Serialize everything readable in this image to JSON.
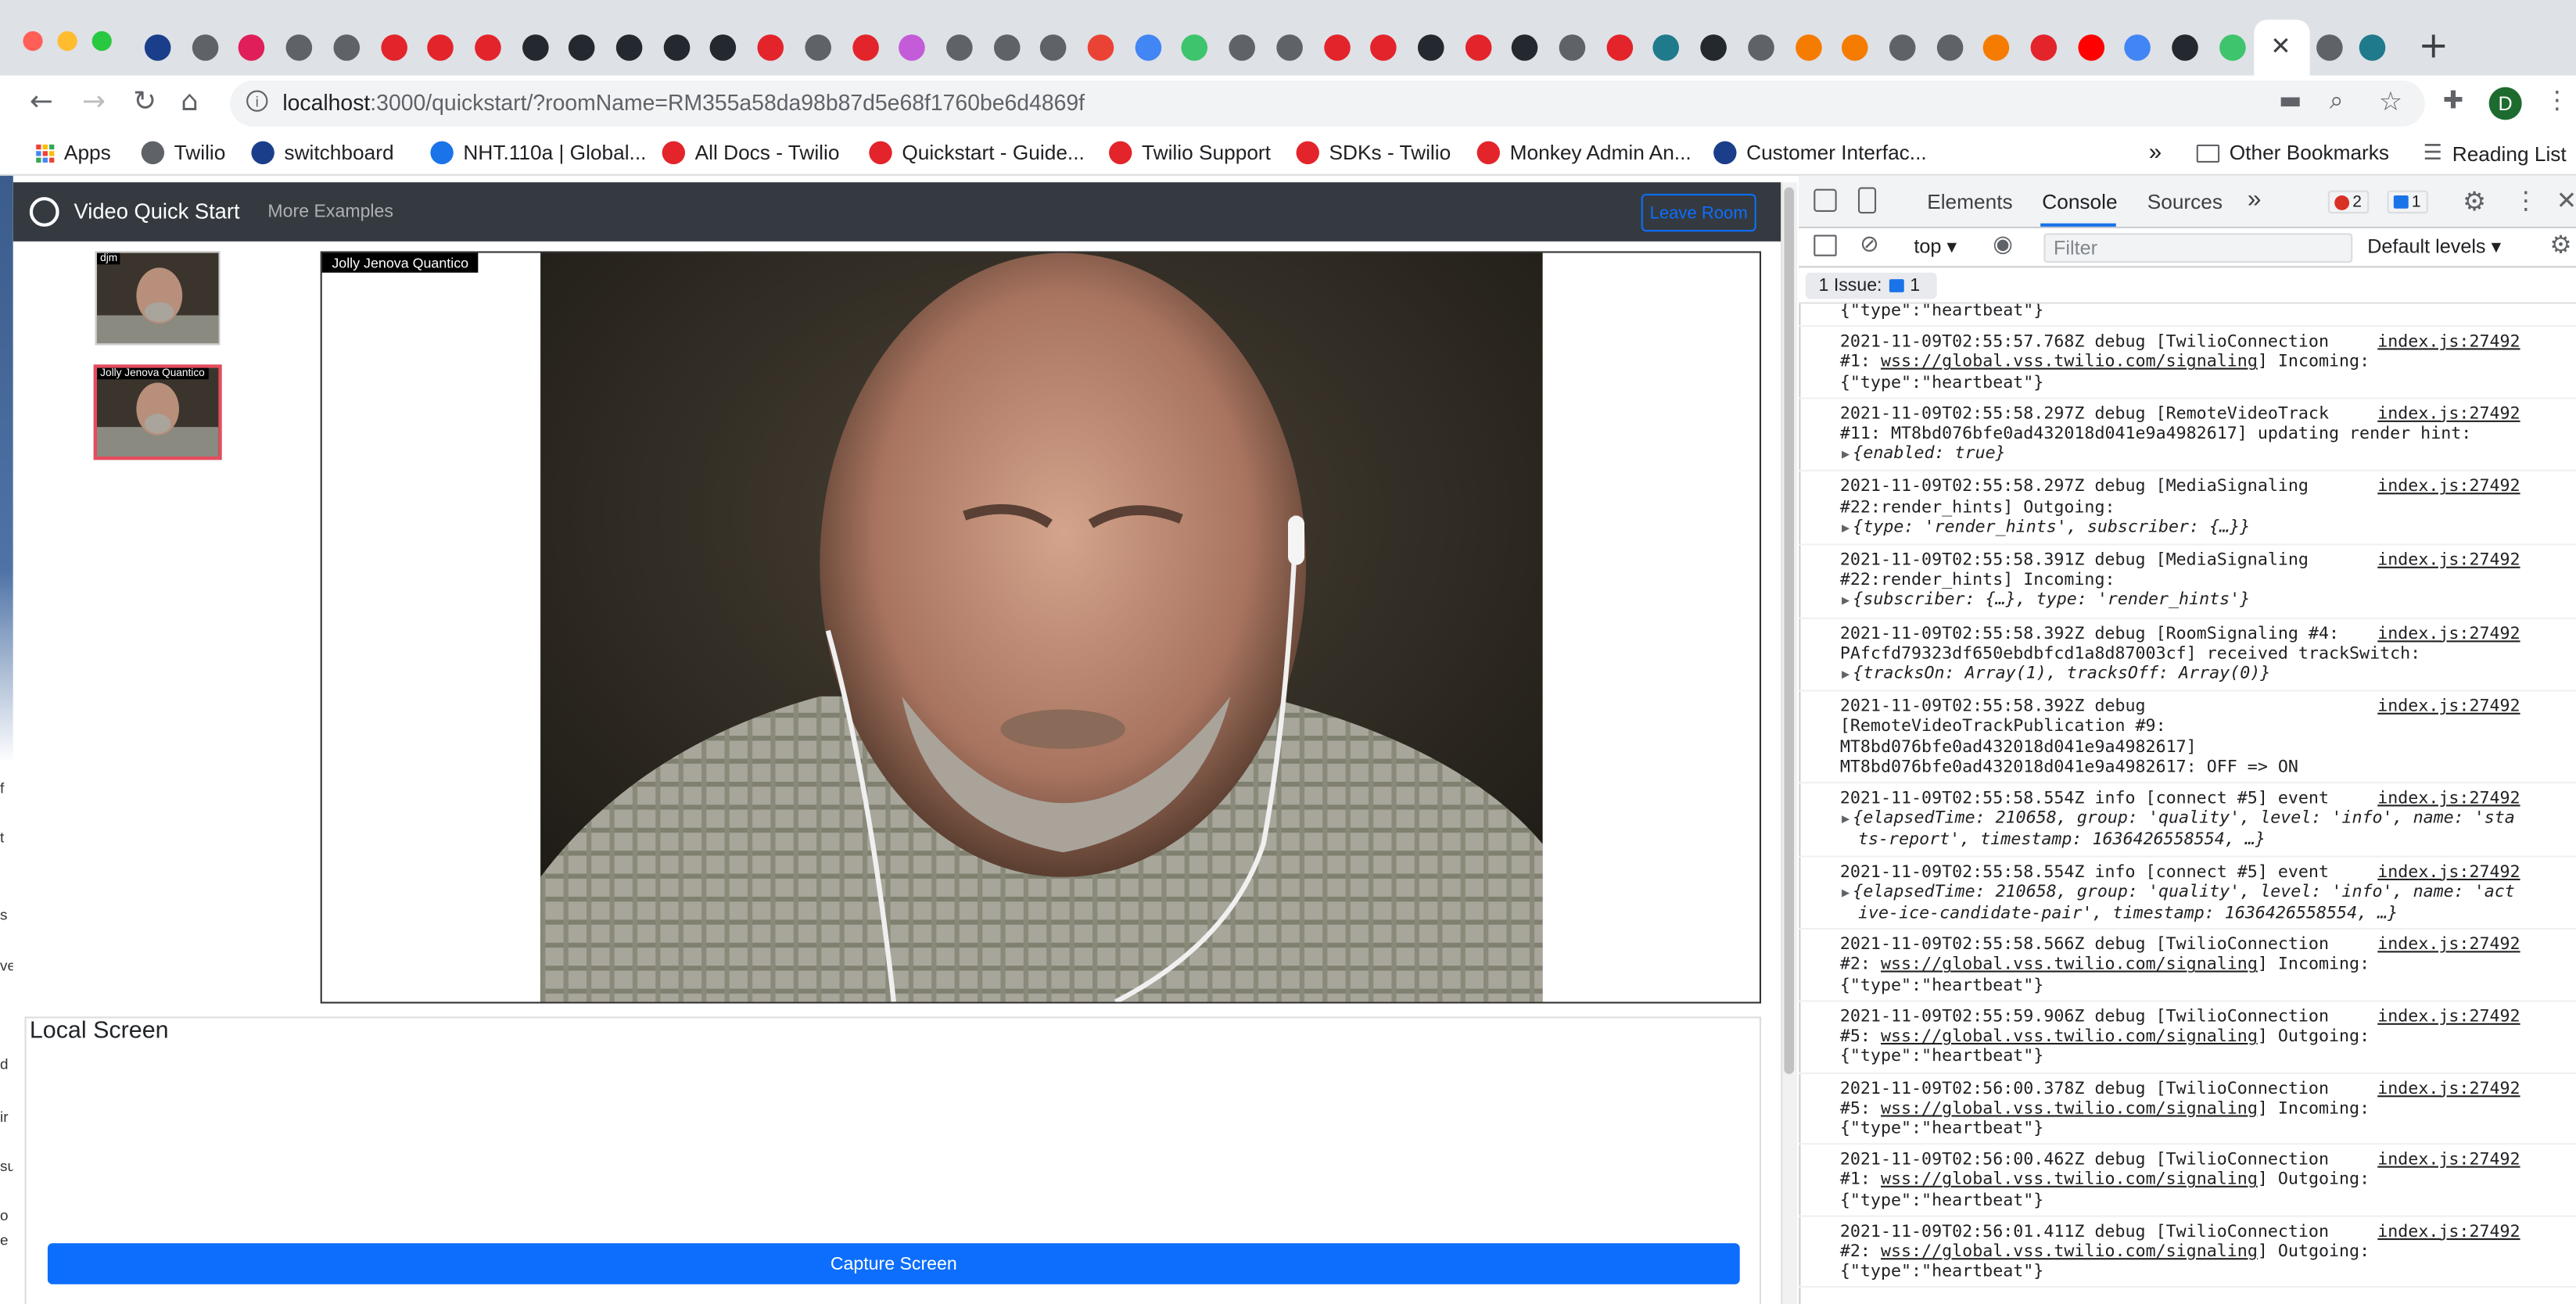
{
  "browser": {
    "url_host": "localhost",
    "url_path": ":3000/quickstart/?roomName=RM355a58da98b87d5e68f1760be6d4869f",
    "profile_initial": "D",
    "tab_icon_colors": [
      "#1a3e8a",
      "#5f6368",
      "#e01e5a",
      "#5f6368",
      "#5f6368",
      "#e3242b",
      "#e3242b",
      "#e3242b",
      "#24292f",
      "#24292f",
      "#24292f",
      "#24292f",
      "#24292f",
      "#e3242b",
      "#5f6368",
      "#e3242b",
      "#c45bd8",
      "#5f6368",
      "#5f6368",
      "#5f6368",
      "#ea4335",
      "#4285f4",
      "#3ec46d",
      "#5f6368",
      "#5f6368",
      "#e3242b",
      "#e3242b",
      "#24292f",
      "#e3242b",
      "#24292f",
      "#5f6368",
      "#e3242b",
      "#1f7a8c",
      "#24292f",
      "#5f6368",
      "#f57c00",
      "#f57c00",
      "#5f6368",
      "#5f6368",
      "#f57c00",
      "#e3242b",
      "#ff0000",
      "#4285f4",
      "#24292f",
      "#3ec46d",
      "#e3242b"
    ]
  },
  "bookmarks": {
    "apps": "Apps",
    "items": [
      {
        "label": "Twilio",
        "color": "#5f6368"
      },
      {
        "label": "switchboard",
        "color": "#1a3e8a"
      },
      {
        "label": "NHT.110a | Global...",
        "color": "#1a73e8"
      },
      {
        "label": "All Docs - Twilio",
        "color": "#e3242b"
      },
      {
        "label": "Quickstart - Guide...",
        "color": "#e3242b"
      },
      {
        "label": "Twilio Support",
        "color": "#e3242b"
      },
      {
        "label": "SDKs - Twilio",
        "color": "#e3242b"
      },
      {
        "label": "Monkey Admin An...",
        "color": "#e3242b"
      },
      {
        "label": "Customer Interfac...",
        "color": "#1a3e8a"
      }
    ],
    "overflow": "»",
    "other": "Other Bookmarks",
    "reading_list": "Reading List"
  },
  "app": {
    "brand": "Video Quick Start",
    "more_examples": "More Examples",
    "leave_room": "Leave Room",
    "participants": [
      {
        "label": "djm",
        "selected": false
      },
      {
        "label": "Jolly Jenova Quantico",
        "selected": true
      }
    ],
    "main_video_label": "Jolly Jenova Quantico",
    "local_screen_title": "Local Screen",
    "capture_button": "Capture Screen",
    "left_strip_letters": [
      "f",
      "t",
      "s",
      "ve",
      "d",
      "ir",
      "su",
      "o",
      "e"
    ]
  },
  "devtools": {
    "tabs": [
      "Elements",
      "Console",
      "Sources"
    ],
    "active_tab": "Console",
    "more_tabs": "»",
    "error_count": "2",
    "info_count": "1",
    "context": "top",
    "filter_placeholder": "Filter",
    "levels": "Default levels",
    "issues_label": "1 Issue:",
    "issues_count": "1",
    "partial_top": "{\"type\":\"heartbeat\"}",
    "entries": [
      {
        "src": "index.js:27492",
        "line1": "2021-11-09T02:55:57.768Z debug [TwilioConnection",
        "line2a": "#1: ",
        "link": "wss://global.vss.twilio.com/signaling",
        "line2b": "] Incoming:",
        "line3": "{\"type\":\"heartbeat\"}"
      },
      {
        "src": "index.js:27492",
        "line1": "2021-11-09T02:55:58.297Z debug [RemoteVideoTrack",
        "line2": "#11: MT8bd076bfe0ad432018d041e9a4982617] updating render hint:",
        "obj": "{enabled: true}"
      },
      {
        "src": "index.js:27492",
        "line1": "2021-11-09T02:55:58.297Z debug [MediaSignaling",
        "line2": "#22:render_hints] Outgoing:",
        "obj": "{type: 'render_hints', subscriber: {…}}"
      },
      {
        "src": "index.js:27492",
        "line1": "2021-11-09T02:55:58.391Z debug [MediaSignaling",
        "line2": "#22:render_hints] Incoming:",
        "obj": "{subscriber: {…}, type: 'render_hints'}"
      },
      {
        "src": "index.js:27492",
        "line1": "2021-11-09T02:55:58.392Z debug [RoomSignaling #4:",
        "line2": "PAfcfd79323df650ebdbfcd1a8d87003cf] received trackSwitch:",
        "obj": "{tracksOn: Array(1), tracksOff: Array(0)}"
      },
      {
        "src": "index.js:27492",
        "line1": "2021-11-09T02:55:58.392Z debug",
        "line2": "[RemoteVideoTrackPublication #9:",
        "line3": "MT8bd076bfe0ad432018d041e9a4982617]",
        "line4": "MT8bd076bfe0ad432018d041e9a4982617: OFF => ON"
      },
      {
        "src": "index.js:27492",
        "line1": "2021-11-09T02:55:58.554Z info [connect #5] event",
        "obj": "{elapsedTime: 210658, group: 'quality', level: 'info', name: 'sta",
        "obj2": "ts-report', timestamp: 1636426558554, …}"
      },
      {
        "src": "index.js:27492",
        "line1": "2021-11-09T02:55:58.554Z info [connect #5] event",
        "obj": "{elapsedTime: 210658, group: 'quality', level: 'info', name: 'act",
        "obj2": "ive-ice-candidate-pair', timestamp: 1636426558554, …}"
      },
      {
        "src": "index.js:27492",
        "line1": "2021-11-09T02:55:58.566Z debug [TwilioConnection",
        "line2a": "#2: ",
        "link": "wss://global.vss.twilio.com/signaling",
        "line2b": "] Incoming:",
        "line3": "{\"type\":\"heartbeat\"}"
      },
      {
        "src": "index.js:27492",
        "line1": "2021-11-09T02:55:59.906Z debug [TwilioConnection",
        "line2a": "#5: ",
        "link": "wss://global.vss.twilio.com/signaling",
        "line2b": "] Outgoing:",
        "line3": "{\"type\":\"heartbeat\"}"
      },
      {
        "src": "index.js:27492",
        "line1": "2021-11-09T02:56:00.378Z debug [TwilioConnection",
        "line2a": "#5: ",
        "link": "wss://global.vss.twilio.com/signaling",
        "line2b": "] Incoming:",
        "line3": "{\"type\":\"heartbeat\"}"
      },
      {
        "src": "index.js:27492",
        "line1": "2021-11-09T02:56:00.462Z debug [TwilioConnection",
        "line2a": "#1: ",
        "link": "wss://global.vss.twilio.com/signaling",
        "line2b": "] Outgoing:",
        "line3": "{\"type\":\"heartbeat\"}"
      },
      {
        "src": "index.js:27492",
        "line1": "2021-11-09T02:56:01.411Z debug [TwilioConnection",
        "line2a": "#2: ",
        "link": "wss://global.vss.twilio.com/signaling",
        "line2b": "] Outgoing:",
        "line3": "{\"type\":\"heartbeat\"}"
      }
    ]
  },
  "colors": {
    "navbar": "#343a40",
    "primary": "#0d6efd",
    "selected_border": "#e74c5c"
  }
}
